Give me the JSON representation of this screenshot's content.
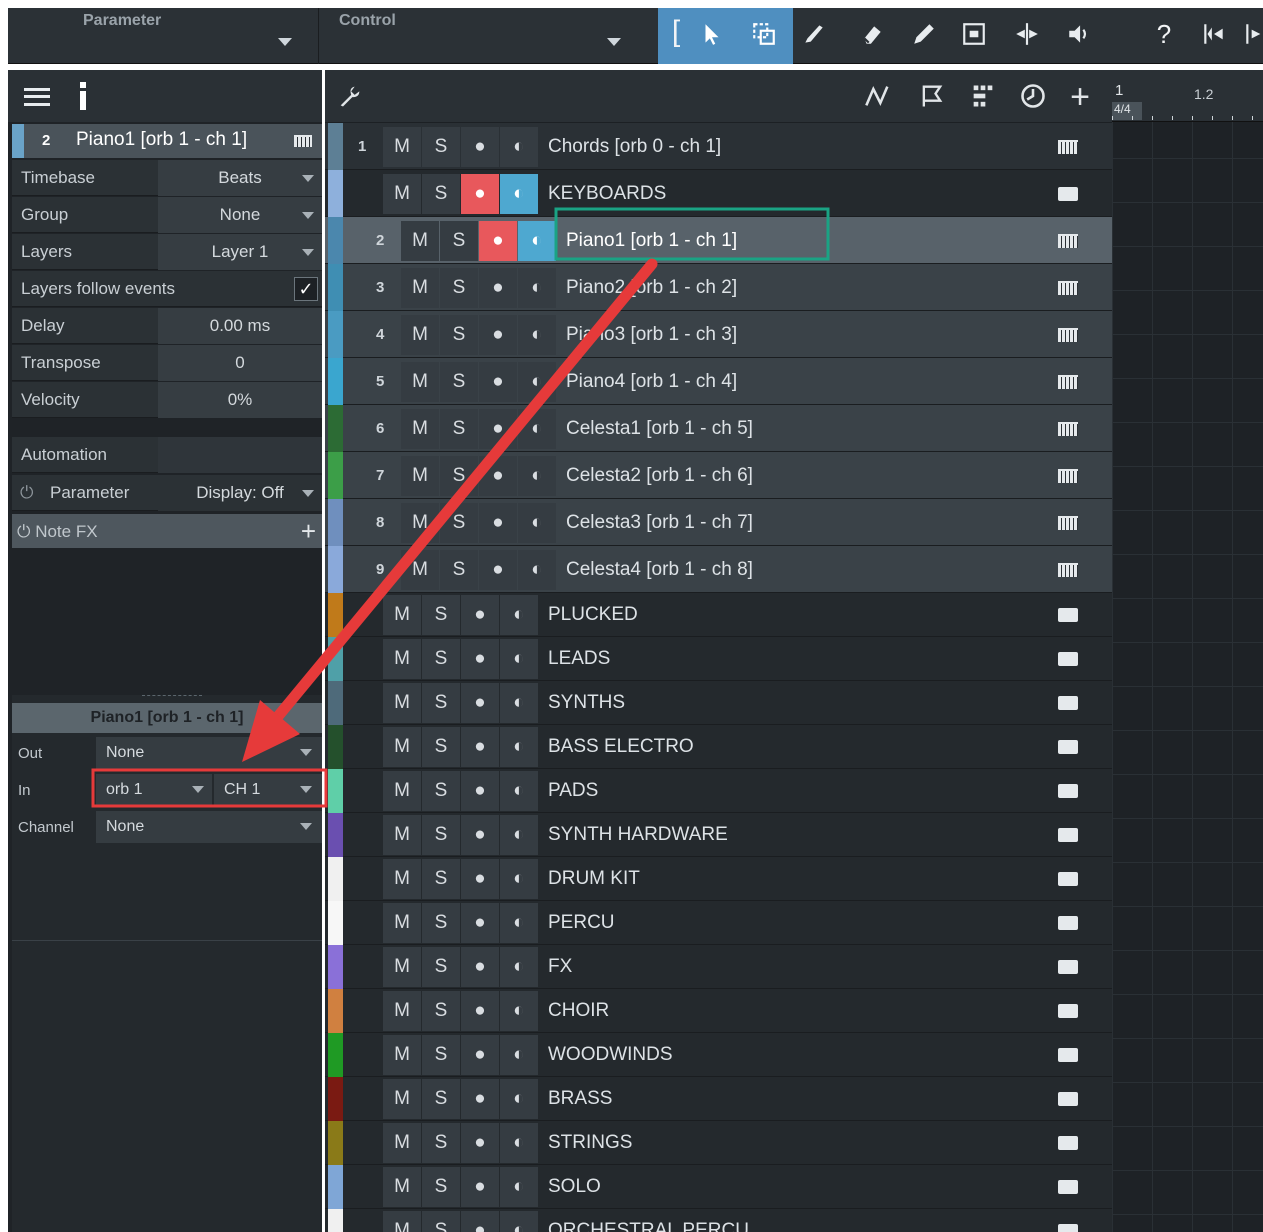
{
  "topbar": {
    "parameter_label": "Parameter",
    "control_label": "Control",
    "help_label": "?"
  },
  "inspector": {
    "track_number": "2",
    "track_name": "Piano1 [orb 1 - ch 1]",
    "rows": [
      {
        "label": "Timebase",
        "value": "Beats",
        "dropdown": true
      },
      {
        "label": "Group",
        "value": "None",
        "dropdown": true
      },
      {
        "label": "Layers",
        "value": "Layer 1",
        "dropdown": true
      },
      {
        "label": "Layers follow events",
        "value": "",
        "checkbox": true,
        "checked": true
      },
      {
        "label": "Delay",
        "value": "0.00 ms"
      },
      {
        "label": "Transpose",
        "value": "0"
      },
      {
        "label": "Velocity",
        "value": "0%"
      }
    ],
    "automation_label": "Automation",
    "parameter_label": "Parameter",
    "parameter_value": "Display: Off",
    "note_fx_label": "Note FX",
    "io": {
      "title": "Piano1 [orb 1 - ch 1]",
      "out_label": "Out",
      "out_value": "None",
      "in_label": "In",
      "in_device": "orb 1",
      "in_channel": "CH 1",
      "channel_label": "Channel",
      "channel_value": "None"
    }
  },
  "ruler": {
    "bar1": "1",
    "bar2": "1.2",
    "time_signature": "4/4"
  },
  "tracks": [
    {
      "num": "1",
      "name": "Chords [orb 0 - ch 1]",
      "type": "instrument",
      "color": "#5d7f95",
      "rec": false,
      "mon": false,
      "selected": false,
      "child": false
    },
    {
      "num": "",
      "name": "KEYBOARDS",
      "type": "folder",
      "color": "#8eb0dc",
      "rec": true,
      "mon": true,
      "selected": false,
      "child": false
    },
    {
      "num": "2",
      "name": "Piano1 [orb 1 - ch 1]",
      "type": "instrument",
      "color": "#4b87ad",
      "rec": true,
      "mon": true,
      "selected": true,
      "child": true
    },
    {
      "num": "3",
      "name": "Piano2 [orb 1 - ch 2]",
      "type": "instrument",
      "color": "#3f8eb3",
      "rec": false,
      "mon": false,
      "selected": false,
      "child": true
    },
    {
      "num": "4",
      "name": "Piano3 [orb 1 - ch 3]",
      "type": "instrument",
      "color": "#4a9bc2",
      "rec": false,
      "mon": false,
      "selected": false,
      "child": true
    },
    {
      "num": "5",
      "name": "Piano4 [orb 1 - ch 4]",
      "type": "instrument",
      "color": "#3aa6cf",
      "rec": false,
      "mon": false,
      "selected": false,
      "child": true
    },
    {
      "num": "6",
      "name": "Celesta1 [orb 1 - ch 5]",
      "type": "instrument",
      "color": "#2c6b34",
      "rec": false,
      "mon": false,
      "selected": false,
      "child": true
    },
    {
      "num": "7",
      "name": "Celesta2 [orb 1 - ch 6]",
      "type": "instrument",
      "color": "#3c9e48",
      "rec": false,
      "mon": false,
      "selected": false,
      "child": true
    },
    {
      "num": "8",
      "name": "Celesta3 [orb 1 - ch 7]",
      "type": "instrument",
      "color": "#6f8fbe",
      "rec": false,
      "mon": false,
      "selected": false,
      "child": true
    },
    {
      "num": "9",
      "name": "Celesta4 [orb 1 - ch 8]",
      "type": "instrument",
      "color": "#8aa9da",
      "rec": false,
      "mon": false,
      "selected": false,
      "child": true
    },
    {
      "num": "",
      "name": "PLUCKED",
      "type": "folder",
      "color": "#c07a1a",
      "rec": false,
      "mon": false,
      "selected": false,
      "child": false
    },
    {
      "num": "",
      "name": "LEADS",
      "type": "folder",
      "color": "#4fa0a8",
      "rec": false,
      "mon": false,
      "selected": false,
      "child": false
    },
    {
      "num": "",
      "name": "SYNTHS",
      "type": "folder",
      "color": "#4e6a7a",
      "rec": false,
      "mon": false,
      "selected": false,
      "child": false
    },
    {
      "num": "",
      "name": "BASS ELECTRO",
      "type": "folder",
      "color": "#24502c",
      "rec": false,
      "mon": false,
      "selected": false,
      "child": false
    },
    {
      "num": "",
      "name": "PADS",
      "type": "folder",
      "color": "#5fcfa8",
      "rec": false,
      "mon": false,
      "selected": false,
      "child": false
    },
    {
      "num": "",
      "name": "SYNTH HARDWARE",
      "type": "folder",
      "color": "#6a4fb0",
      "rec": false,
      "mon": false,
      "selected": false,
      "child": false
    },
    {
      "num": "",
      "name": "DRUM KIT",
      "type": "folder",
      "color": "#f0f0f0",
      "rec": false,
      "mon": false,
      "selected": false,
      "child": false
    },
    {
      "num": "",
      "name": "PERCU",
      "type": "folder",
      "color": "#f7f7f7",
      "rec": false,
      "mon": false,
      "selected": false,
      "child": false
    },
    {
      "num": "",
      "name": "FX",
      "type": "folder",
      "color": "#8a70d8",
      "rec": false,
      "mon": false,
      "selected": false,
      "child": false
    },
    {
      "num": "",
      "name": "CHOIR",
      "type": "folder",
      "color": "#d08040",
      "rec": false,
      "mon": false,
      "selected": false,
      "child": false
    },
    {
      "num": "",
      "name": "WOODWINDS",
      "type": "folder",
      "color": "#1f9a24",
      "rec": false,
      "mon": false,
      "selected": false,
      "child": false
    },
    {
      "num": "",
      "name": "BRASS",
      "type": "folder",
      "color": "#7a1a12",
      "rec": false,
      "mon": false,
      "selected": false,
      "child": false
    },
    {
      "num": "",
      "name": "STRINGS",
      "type": "folder",
      "color": "#8a7a18",
      "rec": false,
      "mon": false,
      "selected": false,
      "child": false
    },
    {
      "num": "",
      "name": "SOLO",
      "type": "folder",
      "color": "#7fa6d6",
      "rec": false,
      "mon": false,
      "selected": false,
      "child": false
    },
    {
      "num": "",
      "name": "ORCHESTRAL PERCU",
      "type": "folder",
      "color": "#f0f0f0",
      "rec": false,
      "mon": false,
      "selected": false,
      "child": false
    }
  ],
  "button_labels": {
    "mute": "M",
    "solo": "S"
  },
  "colors": {
    "record_active": "#e8585c",
    "monitor_active": "#4ea8d0",
    "highlight_teal": "#1aa384",
    "annotation_red": "#e63a3a"
  }
}
